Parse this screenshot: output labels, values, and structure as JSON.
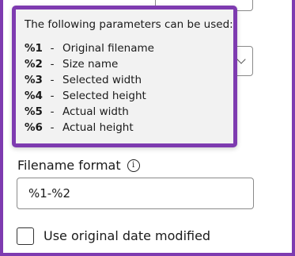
{
  "tooltip": {
    "title": "The following parameters can be used:",
    "params": [
      {
        "code": "%1",
        "dash": "-",
        "desc": "Original filename"
      },
      {
        "code": "%2",
        "dash": "-",
        "desc": "Size name"
      },
      {
        "code": "%3",
        "dash": "-",
        "desc": "Selected width"
      },
      {
        "code": "%4",
        "dash": "-",
        "desc": "Selected height"
      },
      {
        "code": "%5",
        "dash": "-",
        "desc": "Actual width"
      },
      {
        "code": "%6",
        "dash": "-",
        "desc": "Actual height"
      }
    ]
  },
  "filename_format": {
    "label": "Filename format",
    "value": "%1-%2"
  },
  "use_original_date": {
    "label": "Use original date modified",
    "checked": false
  },
  "colors": {
    "highlight_border": "#7e3bb0",
    "tooltip_bg": "#f2f2f2"
  }
}
